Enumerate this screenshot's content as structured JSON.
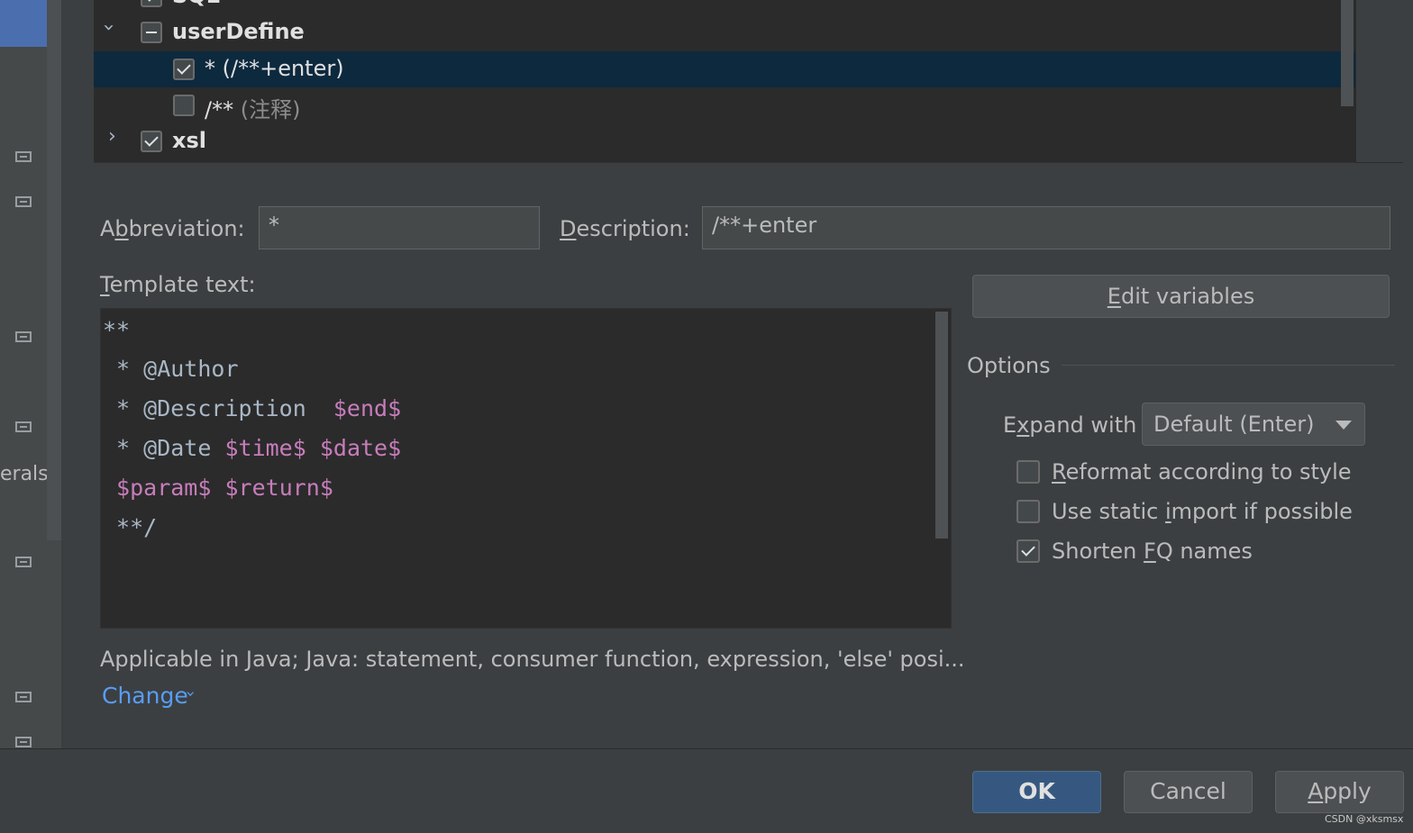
{
  "left_panel": {
    "partial_text": "erals"
  },
  "tree": {
    "rows": [
      {
        "label": "SQL",
        "checked": true
      },
      {
        "label": "userDefine",
        "state": "partial",
        "expanded": true
      },
      {
        "abbr": "*",
        "desc": "(/**+enter)",
        "checked": true,
        "selected": true
      },
      {
        "abbr": "/**",
        "desc": "(注释)",
        "checked": false
      },
      {
        "label": "xsl",
        "checked": true,
        "expanded": false
      }
    ]
  },
  "form": {
    "abbreviation_label_pre": "A",
    "abbreviation_label_u": "b",
    "abbreviation_label_post": "breviation:",
    "abbreviation_value": "*",
    "description_label_u": "D",
    "description_label_post": "escription:",
    "description_value": "/**+enter",
    "template_label_u": "T",
    "template_label_post": "emplate text:"
  },
  "template": {
    "line1": "**",
    "line2": " * @Author",
    "line3_text": " * @Description  ",
    "line3_var": "$end$",
    "line4_text": " * @Date ",
    "line4_var1": "$time$",
    "line4_var2": "$date$",
    "line5_var1": " $param$",
    "line5_var2": "$return$",
    "line6": " **/"
  },
  "options": {
    "edit_variables_u": "E",
    "edit_variables_post": "dit variables",
    "title": "Options",
    "expand_label_pre": "E",
    "expand_label_u": "x",
    "expand_label_post": "pand with",
    "expand_value": "Default (Enter)",
    "reformat_u": "R",
    "reformat_post": "eformat according to style",
    "reformat_checked": false,
    "static_pre": "Use static ",
    "static_u": "i",
    "static_post": "mport if possible",
    "static_checked": false,
    "shorten_pre": "Shorten ",
    "shorten_u": "F",
    "shorten_post": "Q names",
    "shorten_checked": true
  },
  "applicable_text": "Applicable in Java; Java: statement, consumer function, expression, 'else' posi...",
  "change_label": "Change",
  "buttons": {
    "ok": "OK",
    "cancel": "Cancel",
    "apply_u": "A",
    "apply_post": "pply"
  },
  "watermark": "CSDN @xksmsx",
  "colors": {
    "accent": "#4b6eaf",
    "link": "#589df6",
    "template_var": "#c77dbb",
    "selection": "#0d293e"
  }
}
